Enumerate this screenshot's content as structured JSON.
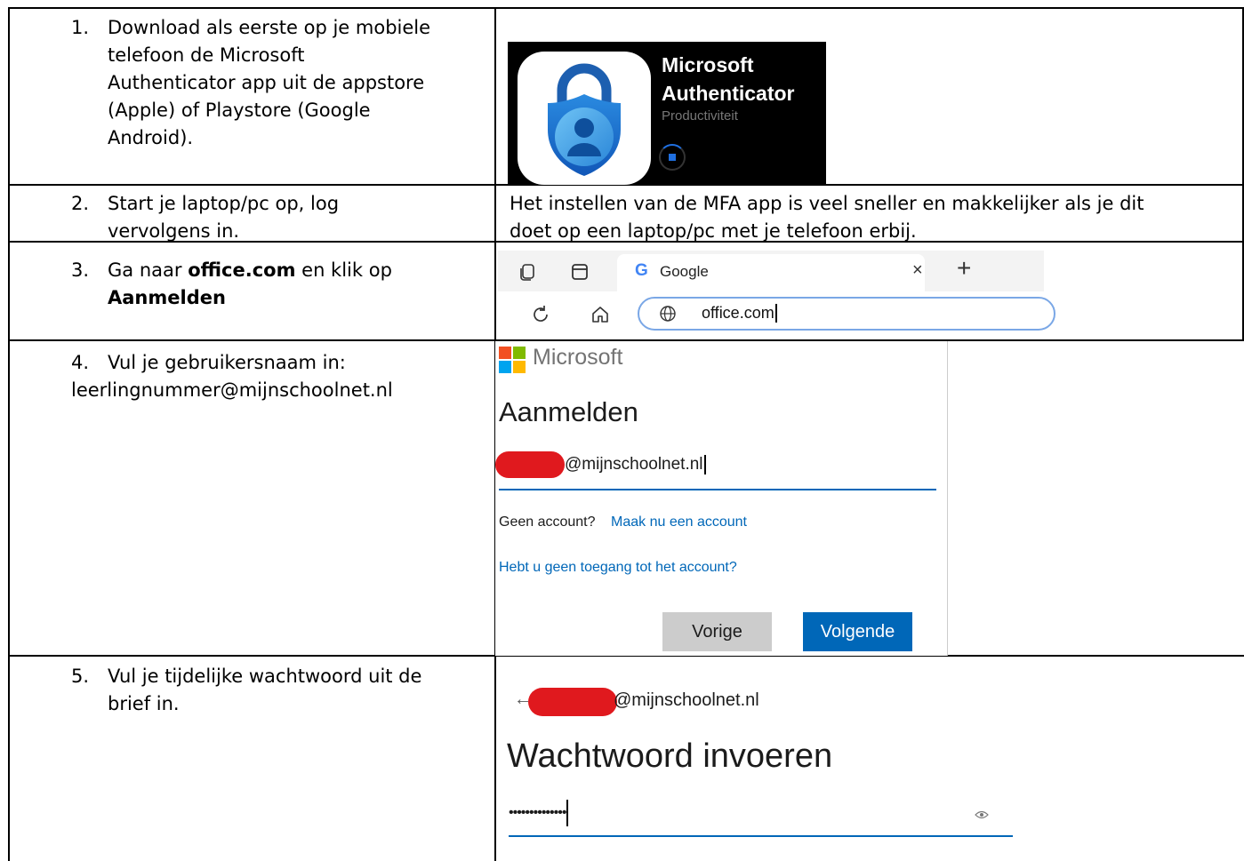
{
  "rows": [
    {
      "number": "1.",
      "lines": [
        "Download als eerste op je mobiele",
        "telefoon de Microsoft",
        "Authenticator app uit de appstore",
        "(Apple) of Playstore (Google",
        "Android)."
      ]
    },
    {
      "number": "2.",
      "lines": [
        "Start je laptop/pc op, log",
        "vervolgens in."
      ],
      "right_lines": [
        "Het instellen van de MFA app is veel sneller en makkelijker als je dit",
        "doet op een laptop/pc met je telefoon erbij."
      ]
    },
    {
      "number": "3.",
      "text_pre": "Ga naar ",
      "bold1": "office.com",
      "text_mid": " en klik op",
      "bold2": "Aanmelden"
    },
    {
      "number": "4.",
      "line1": "Vul je gebruikersnaam in:",
      "line2": "leerlingnummer@mijnschoolnet.nl"
    },
    {
      "number": "5.",
      "lines": [
        "Vul je tijdelijke wachtwoord uit de",
        "brief in."
      ]
    }
  ],
  "app_card": {
    "name_line1": "Microsoft",
    "name_line2": "Authenticator",
    "category": "Productiviteit"
  },
  "browser": {
    "tab_title": "Google",
    "url": "office.com",
    "colors": {
      "tab_bg": "#ffffff",
      "bar_bg": "#f3f3f3"
    }
  },
  "signin": {
    "brand": "Microsoft",
    "heading": "Aanmelden",
    "username_suffix": "@mijnschoolnet.nl",
    "no_account": "Geen account?",
    "create_link": "Maak nu een account",
    "no_access_link": "Hebt u geen toegang tot het account?",
    "back_button": "Vorige",
    "next_button": "Volgende",
    "colors": {
      "primary": "#0067b8",
      "link": "#0067b8"
    }
  },
  "password": {
    "username_suffix": "@mijnschoolnet.nl",
    "heading": "Wachtwoord invoeren",
    "masked": "••••••••••••••"
  }
}
